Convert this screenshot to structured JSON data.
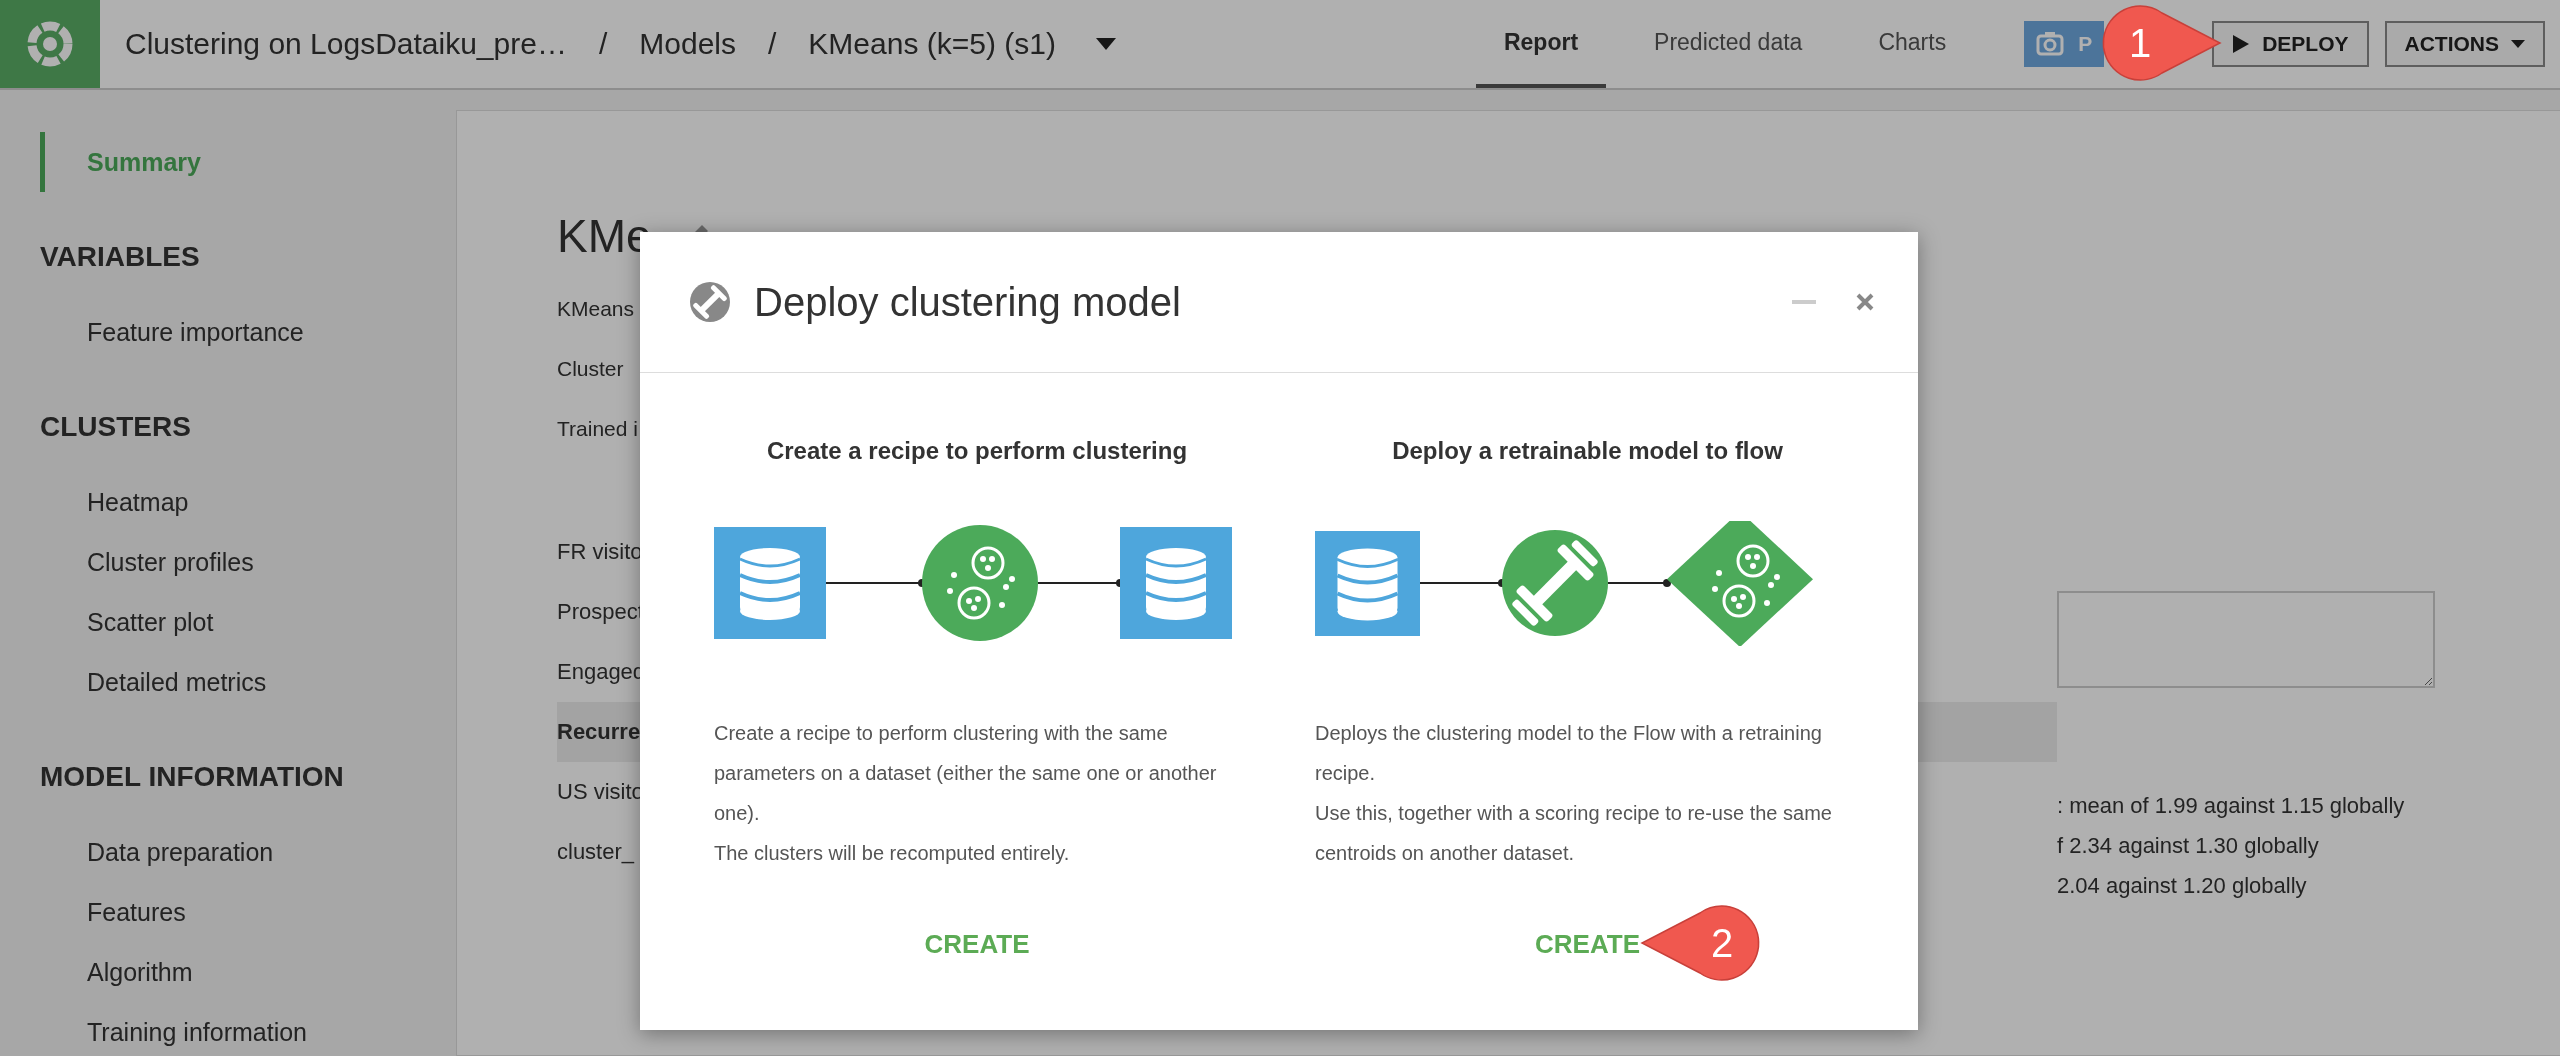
{
  "topbar": {
    "breadcrumb": [
      {
        "kind": "crumb",
        "text": "Clustering on LogsDataiku_pre…"
      },
      {
        "kind": "separator",
        "text": "/"
      },
      {
        "kind": "crumb",
        "text": "Models"
      },
      {
        "kind": "separator",
        "text": "/"
      },
      {
        "kind": "crumb",
        "text": "KMeans (k=5) (s1)"
      }
    ],
    "tabs": [
      {
        "label": "Report",
        "selected": true
      },
      {
        "label": "Predicted data",
        "selected": false
      },
      {
        "label": "Charts",
        "selected": false
      }
    ],
    "buttons": [
      {
        "kind": "publish",
        "label": "P",
        "disabled": true
      },
      {
        "kind": "deploy",
        "label": "DEPLOY",
        "disabled": false
      },
      {
        "kind": "actions",
        "label": "ACTIONS",
        "disabled": false
      }
    ]
  },
  "sidebar": {
    "summary": {
      "label": "Summary",
      "selected": true
    },
    "sections": [
      {
        "heading": "VARIABLES",
        "items": [
          {
            "label": "Feature importance",
            "selected": false
          }
        ]
      },
      {
        "heading": "CLUSTERS",
        "items": [
          {
            "label": "Heatmap",
            "selected": false
          },
          {
            "label": "Cluster profiles",
            "selected": false
          },
          {
            "label": "Scatter plot",
            "selected": false
          },
          {
            "label": "Detailed metrics",
            "selected": false
          }
        ]
      },
      {
        "heading": "MODEL INFORMATION",
        "items": [
          {
            "label": "Data preparation",
            "selected": false
          },
          {
            "label": "Features",
            "selected": false
          },
          {
            "label": "Algorithm",
            "selected": false
          },
          {
            "label": "Training information",
            "selected": false
          }
        ]
      }
    ]
  },
  "report": {
    "title": "KMe",
    "info_lines": [
      "KMeans",
      "Cluster",
      "Trained i"
    ],
    "clusters": [
      {
        "label": "FR visito",
        "selected": false
      },
      {
        "label": "Prospect",
        "selected": false
      },
      {
        "label": "Engaged",
        "selected": false
      },
      {
        "label": "Recurre",
        "selected": true
      },
      {
        "label": "US visito",
        "selected": false
      },
      {
        "label": "cluster_",
        "selected": false
      }
    ],
    "cluster_notes": [
      ": mean of 1.99 against 1.15 globally",
      "f 2.34 against 1.30 globally",
      "2.04 against 1.20 globally"
    ]
  },
  "dialog": {
    "title": "Deploy clustering model",
    "options": [
      {
        "kind": "recipe",
        "heading": "Create a recipe to perform clustering",
        "description": [
          "Create a recipe to perform clustering with the same parameters on a dataset (either the same one or another one).",
          "The clusters will be recomputed entirely."
        ],
        "action": "CREATE"
      },
      {
        "kind": "retrain",
        "heading": "Deploy a retrainable model to flow",
        "description": [
          "Deploys the clustering model to the Flow with a retraining recipe.",
          "Use this, together with a scoring recipe to re-use the same centroids on another dataset."
        ],
        "action": "CREATE"
      }
    ]
  },
  "callouts": [
    {
      "number": "1"
    },
    {
      "number": "2"
    }
  ]
}
